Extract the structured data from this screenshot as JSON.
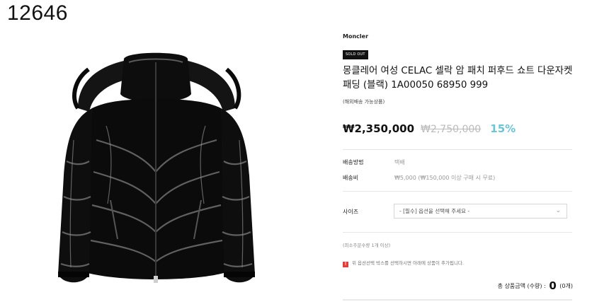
{
  "item_code": "12646",
  "product": {
    "brand": "Moncler",
    "badge": "SOLD OUT",
    "title": "몽클레어 여성 CELAC 셀락 암 패치 퍼후드 쇼트 다운자켓 패딩 (블랙) 1A00050 68950 999",
    "shipping_note": "(해외배송 가능상품)",
    "price": "₩2,350,000",
    "original_price": "₩2,750,000",
    "discount": "15%",
    "image_icon": "black-down-jacket-image"
  },
  "details": {
    "delivery_method_label": "배송방법",
    "delivery_method_value": "택배",
    "shipping_fee_label": "배송비",
    "shipping_fee_value": "₩5,000 (₩150,000 이상 구매 시 무료)"
  },
  "option": {
    "size_label": "사이즈",
    "select_value": "- [필수] 옵션을 선택해 주세요 -"
  },
  "min_quantity": "(최소주문수량 1개 이상)",
  "notice": "위 옵션선택 박스를 선택하시면 아래에 상품이 추가됩니다.",
  "total": {
    "label": "총 상품금액 (수량) :",
    "amount": "0",
    "count": "(0개)"
  },
  "colors": {
    "discount": "#6cc4d6",
    "badge_bg": "#111111",
    "warning": "#e63b3b"
  }
}
